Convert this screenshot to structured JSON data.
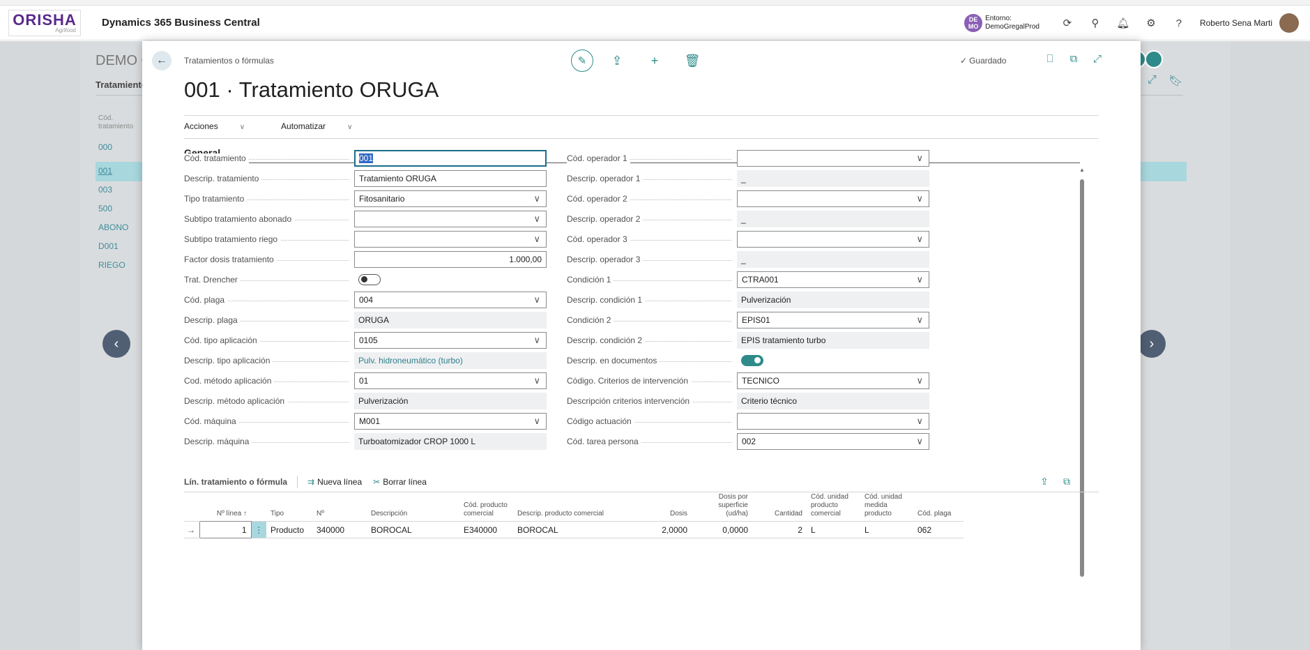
{
  "app": {
    "logo_main": "ORISHA",
    "logo_sub": "Agrifood",
    "name": "Dynamics 365 Business Central",
    "env_badge": "DE MO",
    "env_label": "Entorno:",
    "env_name": "DemoGregalProd",
    "user": "Roberto Sena Marti"
  },
  "background": {
    "title": "DEMO C",
    "tab": "Tratamientos",
    "col_header": "Cód. tratamiento",
    "rows": [
      "000",
      "001",
      "003",
      "500",
      "ABONO",
      "D001",
      "RIEGO"
    ]
  },
  "dialog": {
    "breadcrumb": "Tratamientos o fórmulas",
    "saved": "Guardado",
    "title": "001 · Tratamiento ORUGA",
    "menu": [
      "Acciones",
      "Automatizar"
    ],
    "section": "General",
    "left_fields": [
      {
        "label": "Cód. tratamiento",
        "value": "001"
      },
      {
        "label": "Descrip. tratamiento",
        "value": "Tratamiento ORUGA"
      },
      {
        "label": "Tipo tratamiento",
        "value": "Fitosanitario"
      },
      {
        "label": "Subtipo tratamiento abonado",
        "value": ""
      },
      {
        "label": "Subtipo tratamiento riego",
        "value": ""
      },
      {
        "label": "Factor dosis tratamiento",
        "value": "1.000,00"
      },
      {
        "label": "Trat. Drencher",
        "value": "off"
      },
      {
        "label": "Cód. plaga",
        "value": "004"
      },
      {
        "label": "Descrip. plaga",
        "value": "ORUGA"
      },
      {
        "label": "Cód. tipo aplicación",
        "value": "0105"
      },
      {
        "label": "Descrip. tipo aplicación",
        "value": "Pulv. hidroneumático (turbo)"
      },
      {
        "label": "Cod. método aplicación",
        "value": "01"
      },
      {
        "label": "Descrip. método aplicación",
        "value": "Pulverización"
      },
      {
        "label": "Cód. máquina",
        "value": "M001"
      },
      {
        "label": "Descrip. máquina",
        "value": "Turboatomizador CROP 1000 L"
      }
    ],
    "right_fields": [
      {
        "label": "Cód. operador 1",
        "value": ""
      },
      {
        "label": "Descrip. operador 1",
        "value": "_"
      },
      {
        "label": "Cód. operador 2",
        "value": ""
      },
      {
        "label": "Descrip. operador 2",
        "value": "_"
      },
      {
        "label": "Cód. operador 3",
        "value": ""
      },
      {
        "label": "Descrip. operador 3",
        "value": "_"
      },
      {
        "label": "Condición 1",
        "value": "CTRA001"
      },
      {
        "label": "Descrip. condición 1",
        "value": "Pulverización"
      },
      {
        "label": "Condición 2",
        "value": "EPIS01"
      },
      {
        "label": "Descrip. condición 2",
        "value": "EPIS tratamiento turbo"
      },
      {
        "label": "Descrip. en documentos",
        "value": "on"
      },
      {
        "label": "Código. Criterios de intervención",
        "value": "TECNICO"
      },
      {
        "label": "Descripción criterios intervención",
        "value": "Criterio técnico"
      },
      {
        "label": "Código actuación",
        "value": ""
      },
      {
        "label": "Cód. tarea persona",
        "value": "002"
      }
    ],
    "lines": {
      "title": "Lín. tratamiento o fórmula",
      "new_line": "Nueva línea",
      "delete_line": "Borrar línea",
      "headers": [
        "Nº línea ↑",
        "Tipo",
        "Nº",
        "Descripción",
        "Cód. producto comercial",
        "Descrip. producto comercial",
        "Dosis",
        "Dosis por superficie (ud/ha)",
        "Cantidad",
        "Cód. unidad producto comercial",
        "Cód. unidad medida producto",
        "Cód. plaga"
      ],
      "rows": [
        [
          "1",
          "Producto",
          "340000",
          "BOROCAL",
          "E340000",
          "BOROCAL",
          "2,0000",
          "0,0000",
          "2",
          "L",
          "L",
          "062"
        ]
      ]
    }
  },
  "colors": {
    "accent": "#2e8b89",
    "link": "#2e7f8c",
    "selection": "#a9d7de"
  }
}
